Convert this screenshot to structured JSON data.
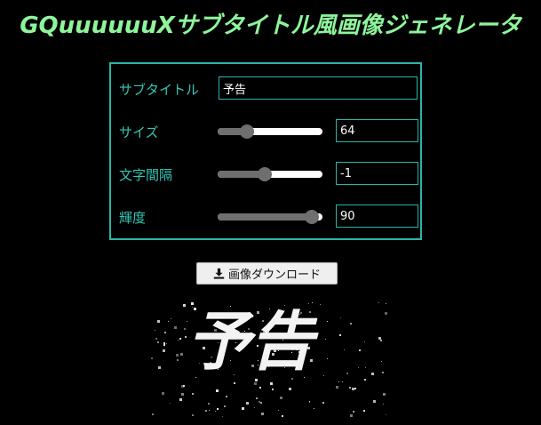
{
  "app": {
    "title": "GQuuuuuuXサブタイトル風画像ジェネレータ"
  },
  "form": {
    "subtitle": {
      "label": "サブタイトル",
      "value": "予告"
    },
    "size": {
      "label": "サイズ",
      "value": "64",
      "level": 0.28
    },
    "spacing": {
      "label": "文字間隔",
      "value": "-1",
      "level": 0.45
    },
    "brightness": {
      "label": "輝度",
      "value": "90",
      "level": 0.9
    }
  },
  "download": {
    "label": "画像ダウンロード",
    "icon": "download-icon"
  },
  "preview": {
    "text": "予告"
  },
  "colors": {
    "title": "#8ef59b",
    "accent": "#2bb5a9",
    "label": "#33c6b4",
    "background": "#000000"
  }
}
